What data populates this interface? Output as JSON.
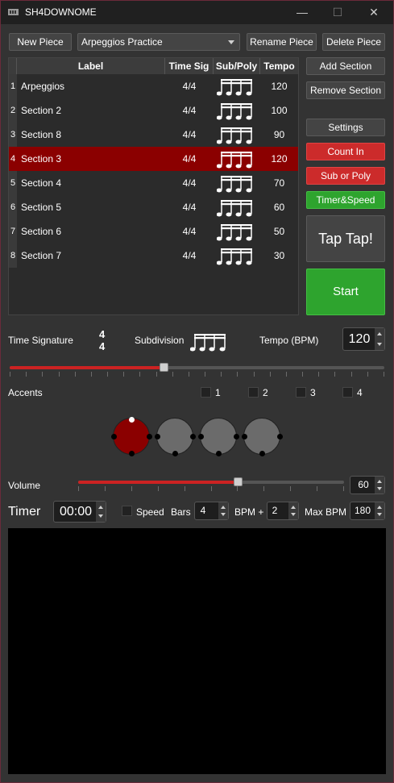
{
  "window": {
    "title": "SH4DOWNOME",
    "minimize": "—",
    "maximize": "☐",
    "close": "✕"
  },
  "toolbar": {
    "new_piece": "New Piece",
    "piece_selected": "Arpeggios Practice",
    "rename_piece": "Rename Piece",
    "delete_piece": "Delete Piece"
  },
  "table": {
    "headers": [
      "Label",
      "Time Sig",
      "Sub/Poly",
      "Tempo"
    ],
    "rows": [
      {
        "num": "1",
        "label": "Arpeggios",
        "time_sig": "4/4",
        "tempo": "120"
      },
      {
        "num": "2",
        "label": "Section 2",
        "time_sig": "4/4",
        "tempo": "100"
      },
      {
        "num": "3",
        "label": "Section 8",
        "time_sig": "4/4",
        "tempo": "90"
      },
      {
        "num": "4",
        "label": "Section 3",
        "time_sig": "4/4",
        "tempo": "120"
      },
      {
        "num": "5",
        "label": "Section 4",
        "time_sig": "4/4",
        "tempo": "70"
      },
      {
        "num": "6",
        "label": "Section 5",
        "time_sig": "4/4",
        "tempo": "60"
      },
      {
        "num": "7",
        "label": "Section 6",
        "time_sig": "4/4",
        "tempo": "50"
      },
      {
        "num": "8",
        "label": "Section 7",
        "time_sig": "4/4",
        "tempo": "30"
      }
    ],
    "selected_row": 4
  },
  "side": {
    "add_section": "Add Section",
    "remove_section": "Remove Section",
    "settings": "Settings",
    "count_in": "Count In",
    "sub_or_poly": "Sub or Poly",
    "timer_speed": "Timer&Speed",
    "tap": "Tap Tap!",
    "start": "Start"
  },
  "controls": {
    "time_signature_label": "Time Signature",
    "ts_top": "4",
    "ts_bottom": "4",
    "subdivision_label": "Subdivision",
    "tempo_label": "Tempo (BPM)",
    "tempo_value": "120",
    "tempo_slider_fraction": 0.41,
    "accents_label": "Accents",
    "accent_checks": [
      "1",
      "2",
      "3",
      "4"
    ],
    "volume_label": "Volume",
    "volume_value": "60",
    "volume_fraction": 0.6
  },
  "timer": {
    "label": "Timer",
    "time": "00:00",
    "speed_label": "Speed",
    "bars_label": "Bars",
    "bars_value": "4",
    "bpm_plus_label": "BPM +",
    "bpm_plus_value": "2",
    "max_bpm_label": "Max BPM",
    "max_bpm_value": "180"
  },
  "colors": {
    "background": "#333333",
    "selected_row": "#8b0000",
    "red_button": "#cc2b2b",
    "green_button": "#2ea42e",
    "active_beat": "#8b0000",
    "inactive_beat": "#6b6b6b"
  }
}
